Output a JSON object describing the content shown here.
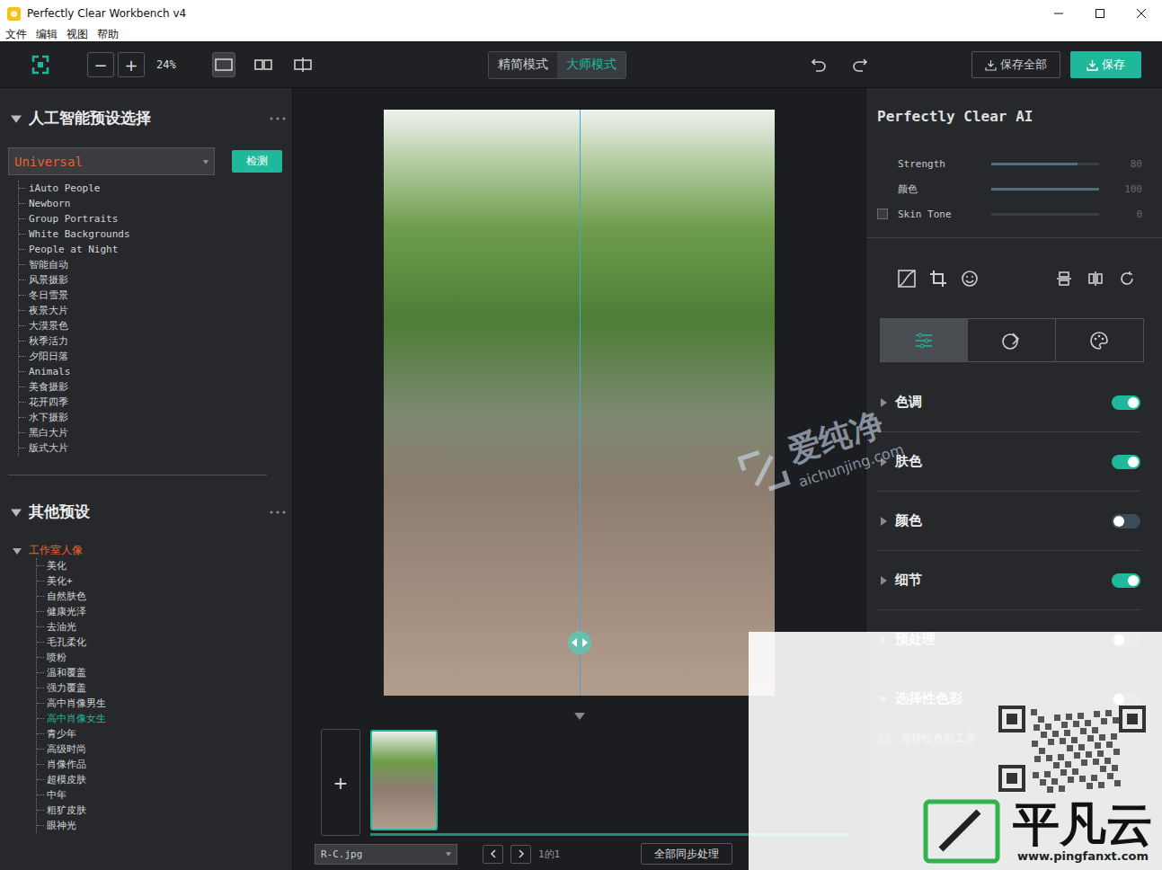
{
  "window": {
    "title": "Perfectly Clear Workbench v4"
  },
  "menu": [
    "文件",
    "编辑",
    "视图",
    "帮助"
  ],
  "toolbar": {
    "zoom_out": "−",
    "zoom_in": "+",
    "zoom": "24%",
    "views": [
      {
        "selected": true
      },
      {
        "selected": false
      },
      {
        "selected": false
      }
    ],
    "modes": [
      {
        "label": "精简模式",
        "selected": false
      },
      {
        "label": "大师模式",
        "selected": true
      }
    ],
    "save_all": "保存全部",
    "save": "保存"
  },
  "ai_presets": {
    "title": "人工智能预设选择",
    "dropdown": "Universal",
    "detect": "检测",
    "items": [
      "iAuto People",
      "Newborn",
      "Group Portraits",
      "White Backgrounds",
      "People at Night",
      "智能自动",
      "风景摄影",
      "冬日雪景",
      "夜景大片",
      "大漠景色",
      "秋季活力",
      "夕阳日落",
      "Animals",
      "美食摄影",
      "花开四季",
      "水下摄影",
      "黑白大片",
      "版式大片"
    ]
  },
  "other_presets": {
    "title": "其他预设",
    "groups": [
      {
        "label": "工作室人像",
        "expanded": true,
        "items": [
          {
            "label": "美化",
            "selected": false
          },
          {
            "label": "美化+",
            "selected": false
          },
          {
            "label": "自然肤色",
            "selected": false
          },
          {
            "label": "健康光泽",
            "selected": false
          },
          {
            "label": "去油光",
            "selected": false
          },
          {
            "label": "毛孔柔化",
            "selected": false
          },
          {
            "label": "喷粉",
            "selected": false
          },
          {
            "label": "温和覆盖",
            "selected": false
          },
          {
            "label": "强力覆盖",
            "selected": false
          },
          {
            "label": "高中肖像男生",
            "selected": false
          },
          {
            "label": "高中肖像女生",
            "selected": true
          },
          {
            "label": "青少年",
            "selected": false
          },
          {
            "label": "高级时尚",
            "selected": false
          },
          {
            "label": "肖像作品",
            "selected": false
          },
          {
            "label": "超模皮肤",
            "selected": false
          },
          {
            "label": "中年",
            "selected": false
          },
          {
            "label": "粗犷皮肤",
            "selected": false
          },
          {
            "label": "眼神光",
            "selected": false
          }
        ]
      }
    ]
  },
  "canvas": {
    "compare_level": 0.5
  },
  "watermark": {
    "name": "爱纯净",
    "url": "aichunjing.com"
  },
  "filmstrip": {
    "add": "+",
    "thumbnails": [
      {
        "selected": true
      }
    ]
  },
  "bottom_bar": {
    "file": "R-C.jpg",
    "page": "1的1",
    "sync": "全部同步处理"
  },
  "ai_panel": {
    "title": "Perfectly Clear AI",
    "sliders": [
      {
        "label": "Strength",
        "value": "80",
        "level": 0.8,
        "kind": "slider"
      },
      {
        "label": "颜色",
        "value": "100",
        "level": 1,
        "kind": "slider"
      },
      {
        "label": "Skin Tone",
        "value": "0",
        "level": 0,
        "kind": "checkbox",
        "checked": false
      }
    ]
  },
  "tool_tabs": [
    {
      "selected": true
    },
    {
      "selected": false
    },
    {
      "selected": false
    }
  ],
  "sections": [
    {
      "label": "色调",
      "on": true,
      "expanded": false
    },
    {
      "label": "肤色",
      "on": true,
      "expanded": false
    },
    {
      "label": "颜色",
      "on": false,
      "expanded": false
    },
    {
      "label": "细节",
      "on": true,
      "expanded": false
    },
    {
      "label": "预处理",
      "on": false,
      "expanded": false
    },
    {
      "label": "选择性色彩",
      "on": false,
      "expanded": true
    }
  ],
  "selective_color": {
    "tool": "选择性色彩工具",
    "checked": false
  },
  "badge": {
    "brand": "平凡云",
    "url": "www.pingfanxt.com"
  }
}
